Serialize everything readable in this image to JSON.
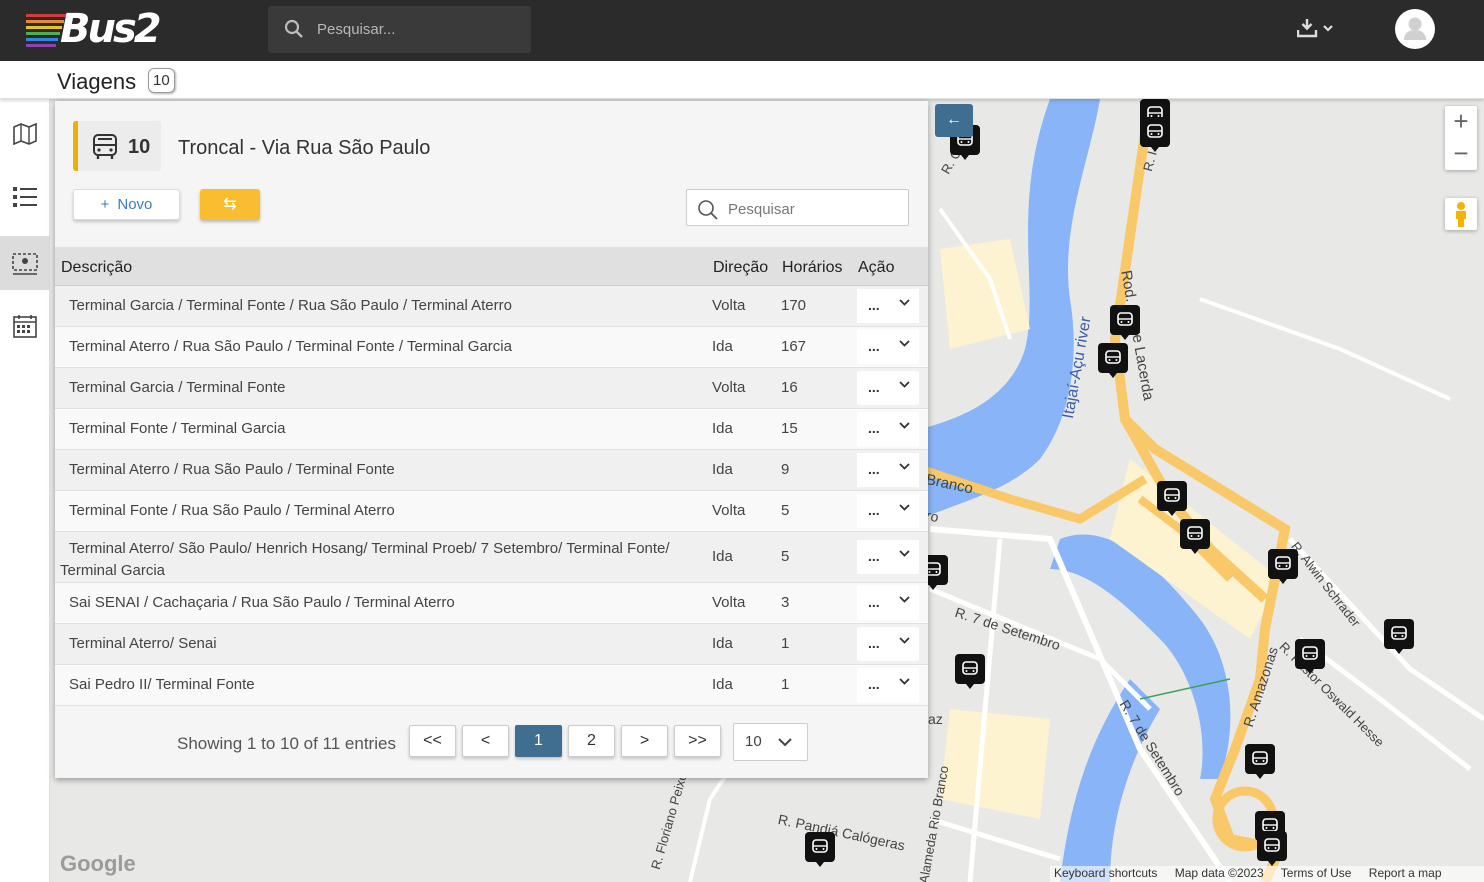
{
  "header": {
    "logo_text": "Bus2",
    "search_placeholder": "Pesquisar...",
    "brand_stripes": [
      "#d63b3b",
      "#e68a2e",
      "#e6c22e",
      "#4caf50",
      "#2e86de",
      "#8e44ad"
    ]
  },
  "page": {
    "title": "Viagens",
    "count": "10"
  },
  "nav": {
    "items": [
      {
        "icon": "map-icon"
      },
      {
        "icon": "list-icon"
      },
      {
        "icon": "route-icon",
        "active": true
      },
      {
        "icon": "calendar-icon"
      }
    ]
  },
  "route": {
    "number": "10",
    "name": "Troncal - Via Rua São Paulo",
    "accent": "#e6b400"
  },
  "toolbar": {
    "new_label": "Novo",
    "back_label": "⇆",
    "search_placeholder": "Pesquisar"
  },
  "table": {
    "headers": {
      "descricao": "Descrição",
      "direcao": "Direção",
      "horarios": "Horários",
      "acao": "Ação"
    },
    "action_label": "...",
    "rows": [
      {
        "descricao": "Terminal Garcia / Terminal Fonte / Rua São Paulo / Terminal Aterro",
        "direcao": "Volta",
        "horarios": "170"
      },
      {
        "descricao": "Terminal Aterro / Rua São Paulo / Terminal Fonte / Terminal Garcia",
        "direcao": "Ida",
        "horarios": "167"
      },
      {
        "descricao": "Terminal Garcia / Terminal Fonte",
        "direcao": "Volta",
        "horarios": "16"
      },
      {
        "descricao": "Terminal Fonte / Terminal Garcia",
        "direcao": "Ida",
        "horarios": "15"
      },
      {
        "descricao": "Terminal Aterro / Rua São Paulo / Terminal Fonte",
        "direcao": "Ida",
        "horarios": "9"
      },
      {
        "descricao": "Terminal Fonte / Rua São Paulo / Terminal Aterro",
        "direcao": "Volta",
        "horarios": "5"
      },
      {
        "descricao": "Terminal Aterro/ São Paulo/ Henrich Hosang/ Terminal Proeb/ 7 Setembro/ Terminal Fonte/ Terminal Garcia",
        "direcao": "Ida",
        "horarios": "5"
      },
      {
        "descricao": "Sai SENAI / Cachaçaria / Rua São Paulo / Terminal Aterro",
        "direcao": "Volta",
        "horarios": "3"
      },
      {
        "descricao": "Terminal Aterro/ Senai",
        "direcao": "Ida",
        "horarios": "1"
      },
      {
        "descricao": "Sai Pedro II/ Terminal Fonte",
        "direcao": "Ida",
        "horarios": "1"
      }
    ]
  },
  "pagination": {
    "info": "Showing 1 to 10 of 11 entries",
    "first": "<<",
    "prev": "<",
    "pages": [
      "1",
      "2"
    ],
    "current": "1",
    "next": ">",
    "last": ">>",
    "per_page": "10"
  },
  "map": {
    "labels": {
      "river": "Itajaí-Açu river",
      "rod": "Rod. Jorge Lacerda",
      "branco": "Branco",
      "ro": "ro",
      "setembro1": "R. 7 de Setembro",
      "setembro2": "R. 7 de Setembro",
      "amazonas": "R. Amazonas",
      "alwin": "R. Alwin Schrader",
      "oswald": "R. Pastor Oswald Hesse",
      "floriano": "R. Floriano Peixoto",
      "pandia": "R. Pandiá Calógeras",
      "riobranco": "Alameda Rio Branco",
      "az": "az",
      "rc": "R. C",
      "rdotn": "R. I"
    },
    "footer": {
      "shortcuts": "Keyboard shortcuts",
      "data": "Map data ©2023",
      "terms": "Terms of Use",
      "report": "Report a map error"
    },
    "attribution": "Google",
    "collapse_label": "←",
    "zoom_in": "+",
    "zoom_out": "−",
    "colors": {
      "water": "#8ab4f8",
      "road": "#f9c868",
      "land": "#e8e8e6"
    }
  }
}
